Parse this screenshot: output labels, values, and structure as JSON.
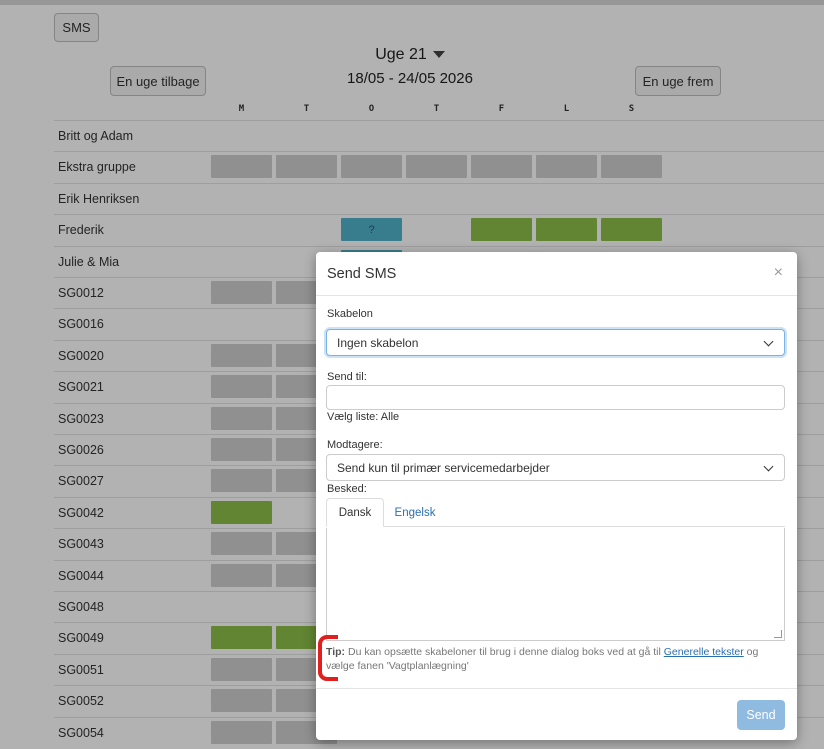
{
  "toolbar": {
    "sms_label": "SMS"
  },
  "week": {
    "title": "Uge 21",
    "range": "18/05 - 24/05 2026",
    "prev_label": "En uge tilbage",
    "next_label": "En uge frem"
  },
  "days": [
    "M",
    "T",
    "O",
    "T",
    "F",
    "L",
    "S"
  ],
  "rows": [
    {
      "name": "Britt og Adam",
      "cells": []
    },
    {
      "name": "Ekstra gruppe",
      "cells": [
        [
          "grey",
          0
        ],
        [
          "grey",
          1
        ],
        [
          "grey",
          2
        ],
        [
          "grey",
          3
        ],
        [
          "grey",
          4
        ],
        [
          "grey",
          5
        ],
        [
          "grey",
          6
        ]
      ]
    },
    {
      "name": "Erik Henriksen",
      "cells": []
    },
    {
      "name": "Frederik",
      "cells": [
        [
          "blue",
          2,
          "?"
        ],
        [
          "green",
          4
        ],
        [
          "green",
          5
        ],
        [
          "green",
          6
        ]
      ]
    },
    {
      "name": "Julie & Mia",
      "cells": [
        [
          "blue",
          2
        ]
      ]
    },
    {
      "name": "SG0012",
      "cells": [
        [
          "grey",
          0
        ],
        [
          "grey",
          1
        ]
      ]
    },
    {
      "name": "SG0016",
      "cells": []
    },
    {
      "name": "SG0020",
      "cells": [
        [
          "grey",
          0
        ],
        [
          "grey",
          1
        ]
      ]
    },
    {
      "name": "SG0021",
      "cells": [
        [
          "grey",
          0
        ],
        [
          "grey",
          1
        ]
      ]
    },
    {
      "name": "SG0023",
      "cells": [
        [
          "grey",
          0
        ],
        [
          "grey",
          1
        ]
      ]
    },
    {
      "name": "SG0026",
      "cells": [
        [
          "grey",
          0
        ],
        [
          "grey",
          1
        ]
      ]
    },
    {
      "name": "SG0027",
      "cells": [
        [
          "grey",
          0
        ],
        [
          "grey",
          1
        ]
      ]
    },
    {
      "name": "SG0042",
      "cells": [
        [
          "green",
          0
        ]
      ]
    },
    {
      "name": "SG0043",
      "cells": [
        [
          "grey",
          0
        ],
        [
          "grey",
          1
        ]
      ]
    },
    {
      "name": "SG0044",
      "cells": [
        [
          "grey",
          0
        ],
        [
          "grey",
          1
        ]
      ]
    },
    {
      "name": "SG0048",
      "cells": []
    },
    {
      "name": "SG0049",
      "cells": [
        [
          "green",
          0
        ],
        [
          "green",
          1
        ]
      ]
    },
    {
      "name": "SG0051",
      "cells": [
        [
          "grey",
          0
        ],
        [
          "grey",
          1
        ]
      ]
    },
    {
      "name": "SG0052",
      "cells": [
        [
          "grey",
          0
        ],
        [
          "grey",
          1
        ]
      ]
    },
    {
      "name": "SG0054",
      "cells": [
        [
          "grey",
          0
        ],
        [
          "grey",
          1
        ]
      ]
    }
  ],
  "modal": {
    "title": "Send SMS",
    "close": "×",
    "template_label": "Skabelon",
    "template_value": "Ingen skabelon",
    "sendto_label": "Send til:",
    "sendto_value": "",
    "list_label": "Vælg liste: Alle",
    "recipients_label": "Modtagere:",
    "recipients_value": "Send kun til primær servicemedarbejder",
    "message_label": "Besked:",
    "tab_danish": "Dansk",
    "tab_english": "Engelsk",
    "tip_bold": "Tip:",
    "tip_text": " Du kan opsætte skabeloner til brug i denne dialog boks ved at gå til ",
    "tip_link": "Generelle tekster",
    "tip_end": " og vælge fanen 'Vagtplanlægning'",
    "send_label": "Send"
  },
  "colors": {
    "grey": "#cfcfcf",
    "green": "#8bbf48",
    "blue": "#4fb3cc",
    "annotation": "#e0201e"
  }
}
